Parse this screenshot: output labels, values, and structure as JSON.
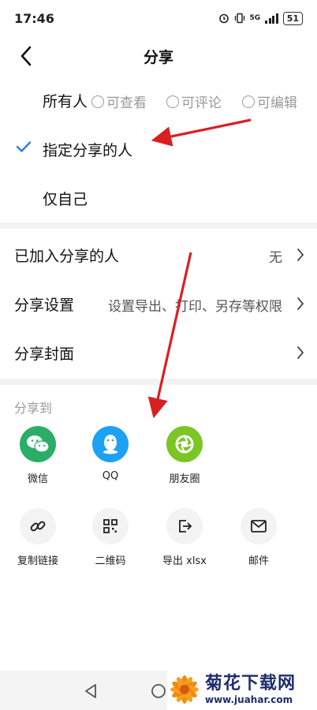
{
  "status_bar": {
    "time": "17:46",
    "network": "5G",
    "battery": "51"
  },
  "header": {
    "title": "分享"
  },
  "visibility": {
    "options": [
      {
        "label": "所有人",
        "selected": false
      },
      {
        "label": "指定分享的人",
        "selected": true
      },
      {
        "label": "仅自己",
        "selected": false
      }
    ],
    "permissions": [
      "可查看",
      "可评论",
      "可编辑"
    ]
  },
  "settings": {
    "rows": [
      {
        "label": "已加入分享的人",
        "value": "无"
      },
      {
        "label": "分享设置",
        "value": "设置导出、打印、另存等权限"
      },
      {
        "label": "分享封面",
        "value": ""
      }
    ]
  },
  "share_to": {
    "title": "分享到",
    "apps": [
      {
        "label": "微信",
        "icon": "wechat-icon",
        "color": "#2aae67"
      },
      {
        "label": "QQ",
        "icon": "qq-icon",
        "color": "#1da1f2"
      },
      {
        "label": "朋友圈",
        "icon": "moments-icon",
        "color": "#7bc525"
      }
    ],
    "tools": [
      {
        "label": "复制链接",
        "icon": "link-icon"
      },
      {
        "label": "二维码",
        "icon": "qr-code-icon"
      },
      {
        "label": "导出 xlsx",
        "icon": "export-icon"
      },
      {
        "label": "邮件",
        "icon": "mail-icon"
      }
    ]
  },
  "watermark": {
    "title": "菊花下载网",
    "url": "www.juahar.com"
  },
  "colors": {
    "accent": "#2f7bea",
    "annotation": "#d92020"
  }
}
